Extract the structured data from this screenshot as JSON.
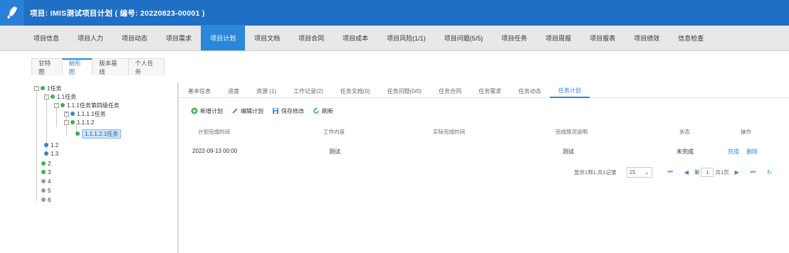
{
  "header": {
    "title": "项目: IMIS测试项目计划 ( 编号: 20220823-00001 )"
  },
  "main_tabs": [
    {
      "label": "项目信息"
    },
    {
      "label": "项目人力"
    },
    {
      "label": "项目动态"
    },
    {
      "label": "项目需求"
    },
    {
      "label": "项目计划",
      "active": true
    },
    {
      "label": "项目文档"
    },
    {
      "label": "项目合同"
    },
    {
      "label": "项目成本"
    },
    {
      "label": "项目风险(1/1)"
    },
    {
      "label": "项目问题(5/5)"
    },
    {
      "label": "项目任务"
    },
    {
      "label": "项目周报"
    },
    {
      "label": "项目报表"
    },
    {
      "label": "项目绩效"
    },
    {
      "label": "信息检查"
    }
  ],
  "sub_tabs": [
    {
      "label": "甘特图"
    },
    {
      "label": "树形图",
      "active": true
    },
    {
      "label": "版本基线"
    },
    {
      "label": "个人任务"
    }
  ],
  "tree": {
    "n1": "1任务",
    "n11": "1.1任务",
    "n111": "1.1.1任务第四级任务",
    "n1111": "1.1.1.1任务",
    "n1112": "1.1.1.2",
    "n11121": "1.1.1.2.1任务",
    "n12": "1.2",
    "n13": "1.3",
    "n2": "2",
    "n3": "3",
    "n4": "4",
    "n5": "5",
    "n6": "6"
  },
  "detail_tabs": [
    {
      "label": "基本信息"
    },
    {
      "label": "进度"
    },
    {
      "label": "资源 (1)"
    },
    {
      "label": "工作记录(2)"
    },
    {
      "label": "任务文档(0)"
    },
    {
      "label": "任务问题(0/0)"
    },
    {
      "label": "任务合同"
    },
    {
      "label": "任务需求"
    },
    {
      "label": "任务动态"
    },
    {
      "label": "任务计划",
      "active": true
    }
  ],
  "toolbar": {
    "add": "新增计划",
    "edit": "编辑计划",
    "save": "保存修改",
    "refresh": "刷新"
  },
  "table": {
    "headers": [
      "计划完成时间",
      "工作内容",
      "实际完成时间",
      "完成情况说明",
      "状态",
      "操作"
    ],
    "rows": [
      {
        "planned_time": "2022-09-13 00:00",
        "content": "测试",
        "actual_time": "",
        "note": "测试",
        "status": "未完成",
        "action_done": "完成",
        "action_delete": "删除"
      }
    ]
  },
  "pager": {
    "summary": "显示1到1,共1记录",
    "page_size": "15",
    "page_prefix": "第",
    "page_value": "1",
    "page_suffix": "共1页"
  },
  "colors": {
    "header": "#1f6fc4",
    "accent": "#2b87d8",
    "green": "#3cb34a"
  }
}
